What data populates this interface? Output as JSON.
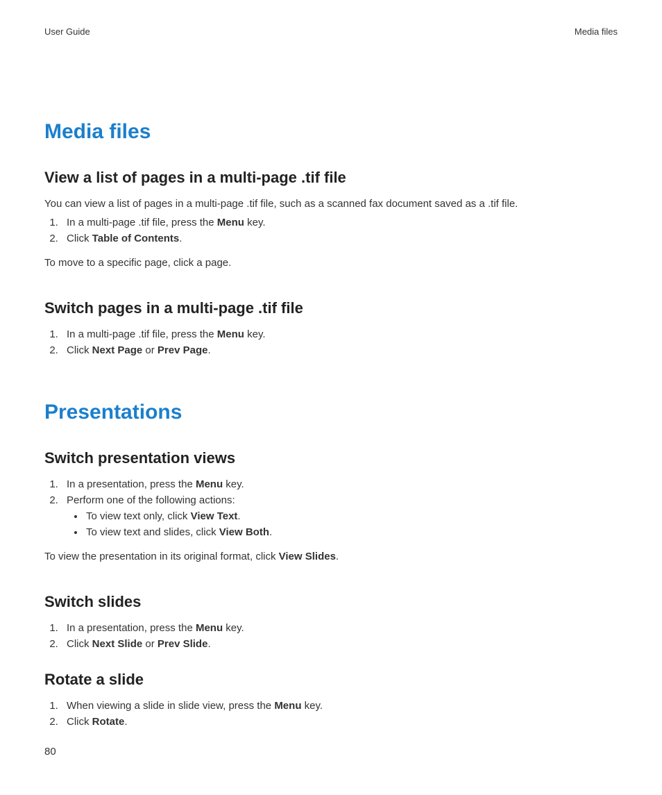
{
  "header": {
    "left": "User Guide",
    "right": "Media files"
  },
  "page_number": "80",
  "sections": [
    {
      "title": "Media files",
      "subsections": [
        {
          "heading": "View a list of pages in a multi-page .tif file",
          "intro": "You can view a list of pages in a multi-page .tif file, such as a scanned fax document saved as a .tif file.",
          "steps": [
            {
              "pre": "In a multi-page .tif file, press the ",
              "bold": "Menu",
              "post": " key."
            },
            {
              "pre": "Click ",
              "bold": "Table of Contents",
              "post": "."
            }
          ],
          "outro": "To move to a specific page, click a page."
        },
        {
          "heading": "Switch pages in a multi-page .tif file",
          "steps": [
            {
              "pre": "In a multi-page .tif file, press the ",
              "bold": "Menu",
              "post": " key."
            },
            {
              "pre": "Click ",
              "bold": "Next Page",
              "mid": " or ",
              "bold2": "Prev Page",
              "post": "."
            }
          ]
        }
      ]
    },
    {
      "title": "Presentations",
      "subsections": [
        {
          "heading": "Switch presentation views",
          "steps": [
            {
              "pre": "In a presentation, press the ",
              "bold": "Menu",
              "post": " key."
            },
            {
              "pre": "Perform one of the following actions:",
              "bullets": [
                {
                  "pre": "To view text only, click ",
                  "bold": "View Text",
                  "post": "."
                },
                {
                  "pre": "To view text and slides, click ",
                  "bold": "View Both",
                  "post": "."
                }
              ]
            }
          ],
          "outro_pre": "To view the presentation in its original format, click ",
          "outro_bold": "View Slides",
          "outro_post": "."
        },
        {
          "heading": "Switch slides",
          "steps": [
            {
              "pre": "In a presentation, press the ",
              "bold": "Menu",
              "post": " key."
            },
            {
              "pre": "Click ",
              "bold": "Next Slide",
              "mid": " or ",
              "bold2": "Prev Slide",
              "post": "."
            }
          ]
        },
        {
          "heading": "Rotate a slide",
          "steps": [
            {
              "pre": "When viewing a slide in slide view, press the ",
              "bold": "Menu",
              "post": " key."
            },
            {
              "pre": "Click ",
              "bold": "Rotate",
              "post": "."
            }
          ]
        }
      ]
    }
  ]
}
